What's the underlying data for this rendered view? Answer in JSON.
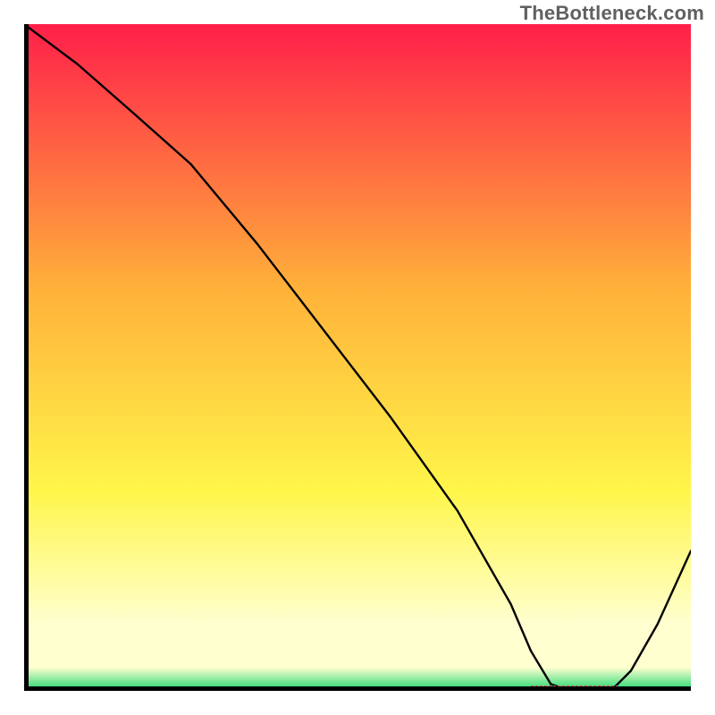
{
  "attribution": "TheBottleneck.com",
  "chart_data": {
    "type": "line",
    "title": "",
    "xlabel": "",
    "ylabel": "",
    "xlim": [
      0,
      100
    ],
    "ylim": [
      0,
      100
    ],
    "grid": false,
    "series": [
      {
        "name": "curve",
        "x": [
          0,
          8,
          16,
          25,
          35,
          45,
          55,
          65,
          73,
          76,
          79,
          82,
          85,
          88,
          91,
          95,
          100
        ],
        "y": [
          100,
          94,
          87,
          79,
          67,
          54,
          41,
          27,
          13,
          6,
          1,
          0,
          0,
          0,
          3,
          10,
          21
        ]
      }
    ],
    "optimal_marker": {
      "x_start": 76,
      "x_end": 89,
      "y": 0.4,
      "color": "#d94a57"
    },
    "background_gradient": {
      "top": "#ff1f4a",
      "mid1": "#ffb23a",
      "mid2": "#fff64a",
      "pale": "#ffffd0",
      "bottom": "#1ad66e"
    },
    "axis_color": "#000000",
    "axis_width": 5,
    "curve_color": "#000000",
    "curve_width": 2.4
  }
}
